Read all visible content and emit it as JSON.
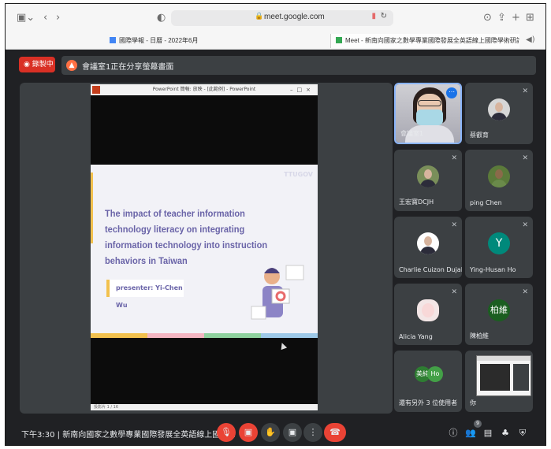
{
  "browser": {
    "url": "meet.google.com",
    "tabs": [
      {
        "label": "國際學報 - 日曆 - 2022年6月"
      },
      {
        "label": "Meet - 新南向國家之數學專業國際發展全英語線上國際學術研討會 (主會議室)"
      }
    ],
    "icons": {
      "sidebar": "sidebar-icon",
      "back": "back-icon",
      "forward": "forward-icon",
      "shield": "shield-icon",
      "lock": "lock-icon",
      "mic": "mic-icon",
      "reload": "reload-icon",
      "download": "download-icon",
      "share": "share-icon",
      "new_tab": "plus-icon",
      "tab_overview": "grid-icon",
      "speaker": "speaker-icon"
    }
  },
  "meet": {
    "recording_label": "錄製中",
    "sharing_text": "會議室1正在分享螢幕畫面",
    "accent_color": "#ea4335"
  },
  "presentation": {
    "window_title": "PowerPoint 簡報: 放映 - [此範例] - PowerPoint",
    "brand": "TTUGOV",
    "slide_title": "The impact of teacher information technology literacy on integrating information technology into instruction behaviors in Taiwan",
    "presenter": "presenter:  Yi-Chen Wu",
    "status": "投影片 1 / 16"
  },
  "participants": [
    {
      "name": "會議室1",
      "type": "camera"
    },
    {
      "name": "蔡叡育",
      "type": "photo",
      "muted": true
    },
    {
      "name": "王宏寶DCJH",
      "type": "photo",
      "muted": true
    },
    {
      "name": "ping Chen",
      "type": "photo",
      "muted": true
    },
    {
      "name": "Charlie Cuizon Dujali",
      "type": "photo",
      "muted": true
    },
    {
      "name": "Ying-Husan Ho",
      "type": "letter",
      "letter": "Y",
      "color": "#00897b",
      "muted": true
    },
    {
      "name": "Alicia Yang",
      "type": "photo",
      "muted": true
    },
    {
      "name": "陳柏維",
      "type": "letter",
      "letter": "柏維",
      "color": "#1b5e20",
      "muted": true
    },
    {
      "name": "還有另外 3 位使用者",
      "type": "others",
      "avatars": [
        "美純",
        "Ho"
      ]
    },
    {
      "name": "你",
      "type": "self"
    }
  ],
  "bottom_bar": {
    "time": "下午3:30",
    "separator": "|",
    "meeting_title": "新南向國家之數學專業國際發展全英語線上國際...",
    "participant_count": "9",
    "controls": [
      "mic-off-icon",
      "camera-off-icon",
      "raise-hand-icon",
      "present-icon",
      "more-icon",
      "end-call-icon"
    ],
    "right_controls": [
      "info-icon",
      "people-icon",
      "chat-icon",
      "activities-icon",
      "host-controls-icon"
    ]
  }
}
